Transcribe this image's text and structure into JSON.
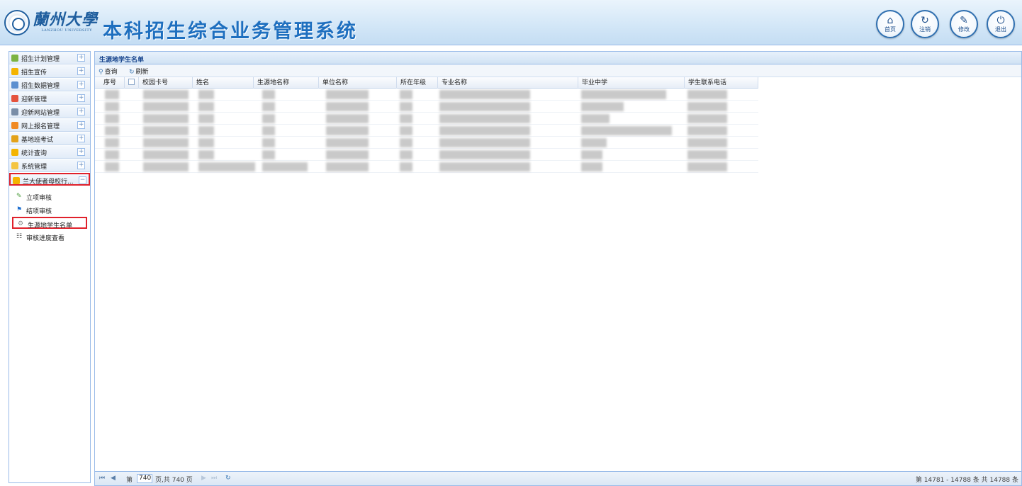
{
  "header": {
    "logo_cn": "蘭州大學",
    "logo_en": "LANZHOU UNIVERSITY",
    "system_title": "本科招生综合业务管理系统",
    "buttons": [
      {
        "label": "首页",
        "icon": "home-icon",
        "glyph": "⌂"
      },
      {
        "label": "注销",
        "icon": "refresh-icon",
        "glyph": "↻"
      },
      {
        "label": "修改",
        "icon": "pencil-icon",
        "glyph": "✎"
      },
      {
        "label": "退出",
        "icon": "power-icon",
        "glyph": "⏻"
      }
    ]
  },
  "sidebar": {
    "items": [
      {
        "label": "招生计划管理",
        "toggle": "+",
        "color": "#7cb342"
      },
      {
        "label": "招生宣传",
        "toggle": "+",
        "color": "#f4b400"
      },
      {
        "label": "招生数据管理",
        "toggle": "+",
        "color": "#5b8fd0"
      },
      {
        "label": "迎新管理",
        "toggle": "+",
        "color": "#e5533d"
      },
      {
        "label": "迎新网站管理",
        "toggle": "+",
        "color": "#7a8ea8"
      },
      {
        "label": "网上报名管理",
        "toggle": "+",
        "color": "#f08a24"
      },
      {
        "label": "基地班考试",
        "toggle": "+",
        "color": "#e3a21a"
      },
      {
        "label": "统计查询",
        "toggle": "+",
        "color": "#f4b400"
      },
      {
        "label": "系统管理",
        "toggle": "+",
        "color": "#f4c542"
      },
      {
        "label": "兰大使者母校行...",
        "toggle": "−",
        "color": "#f4b400"
      }
    ],
    "subitems": [
      {
        "label": "立项审核",
        "glyph": "✎",
        "color": "#4a9b3a"
      },
      {
        "label": "结项审核",
        "glyph": "⚑",
        "color": "#1e6fd0"
      },
      {
        "label": "生源地学生名单",
        "glyph": "⚙",
        "color": "#8a8a8a"
      },
      {
        "label": "审核进度查看",
        "glyph": "☷",
        "color": "#555555"
      }
    ]
  },
  "main": {
    "panel_title": "生源地学生名单",
    "toolbar": {
      "query": "查询",
      "refresh": "刷新"
    },
    "columns": [
      "序号",
      "校园卡号",
      "姓名",
      "生源地名称",
      "单位名称",
      "所在年级",
      "专业名称",
      "毕业中学",
      "学生联系电话"
    ],
    "pager": {
      "prefix": "第",
      "current_page": "740",
      "suffix": "页,共 740 页",
      "info": "第 14781 - 14788 条 共 14788 条"
    }
  }
}
